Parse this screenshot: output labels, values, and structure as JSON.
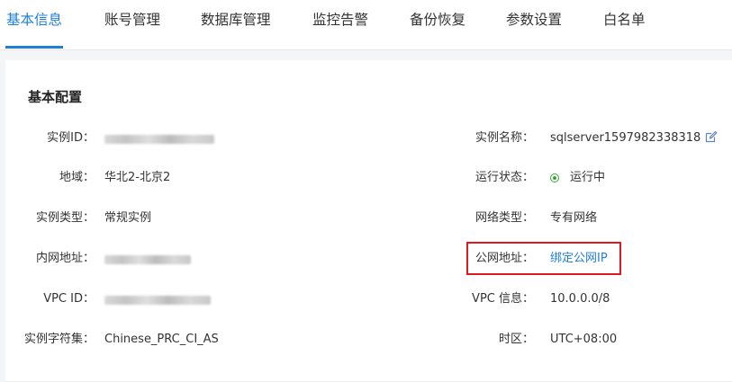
{
  "tabs": [
    {
      "label": "基本信息",
      "active": true
    },
    {
      "label": "账号管理"
    },
    {
      "label": "数据库管理"
    },
    {
      "label": "监控告警"
    },
    {
      "label": "备份恢复"
    },
    {
      "label": "参数设置"
    },
    {
      "label": "白名单"
    }
  ],
  "section": {
    "title": "基本配置"
  },
  "left": {
    "instance_id_label": "实例ID：",
    "region_label": "地域：",
    "region_value": "华北2-北京2",
    "instance_type_label": "实例类型：",
    "instance_type_value": "常规实例",
    "private_ip_label": "内网地址：",
    "vpc_id_label": "VPC ID：",
    "charset_label": "实例字符集：",
    "charset_value": "Chinese_PRC_CI_AS"
  },
  "right": {
    "instance_name_label": "实例名称：",
    "instance_name_value": "sqlserver1597982338318",
    "status_label": "运行状态：",
    "status_value": "运行中",
    "network_type_label": "网络类型：",
    "network_type_value": "专有网络",
    "public_ip_label": "公网地址：",
    "public_ip_link": "绑定公网IP",
    "vpc_info_label": "VPC 信息：",
    "vpc_info_value": "10.0.0.0/8",
    "timezone_label": "时区：",
    "timezone_value": "UTC+08:00"
  },
  "icons": {
    "edit": "edit-icon",
    "status": "status-running-icon"
  },
  "colors": {
    "accent": "#1f7fd6",
    "status_green": "#3aa53a",
    "highlight_red": "#e0191e"
  }
}
